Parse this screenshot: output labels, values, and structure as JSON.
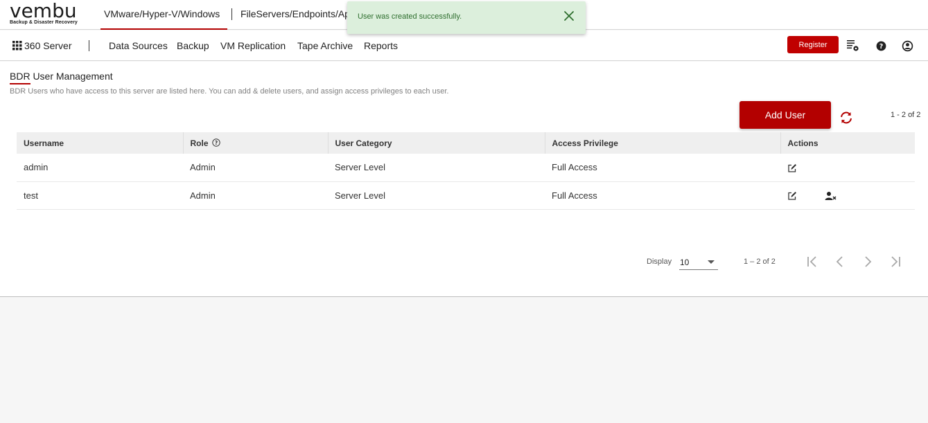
{
  "header": {
    "logo_text": "vembu",
    "logo_subtitle": "Backup & Disaster Recovery",
    "product_tabs": [
      {
        "label": "VMware/Hyper-V/Windows"
      },
      {
        "label": "FileServers/Endpoints/Ap"
      }
    ]
  },
  "toast": {
    "message": "User was created successfully."
  },
  "nav": {
    "server_label": "360 Server",
    "items": [
      {
        "label": "Data Sources"
      },
      {
        "label": "Backup"
      },
      {
        "label": "VM Replication"
      },
      {
        "label": "Tape Archive"
      },
      {
        "label": "Reports"
      }
    ],
    "register_label": "Register"
  },
  "page": {
    "title": "BDR User Management",
    "description": "BDR Users who have access to this server are listed here. You can add & delete users, and assign access privileges to each user.",
    "add_user_label": "Add User",
    "range_label": "1 - 2 of 2"
  },
  "table": {
    "columns": [
      "Username",
      "Role",
      "User Category",
      "Access Privilege",
      "Actions"
    ],
    "rows": [
      {
        "username": "admin",
        "role": "Admin",
        "category": "Server Level",
        "privilege": "Full Access"
      },
      {
        "username": "test",
        "role": "Admin",
        "category": "Server Level",
        "privilege": "Full Access"
      }
    ]
  },
  "pagination": {
    "display_label": "Display",
    "page_size": "10",
    "range_label": "1 – 2 of 2"
  },
  "colors": {
    "accent": "#b30000",
    "toast_bg": "#dcefdc",
    "toast_text": "#2e6e2e"
  }
}
